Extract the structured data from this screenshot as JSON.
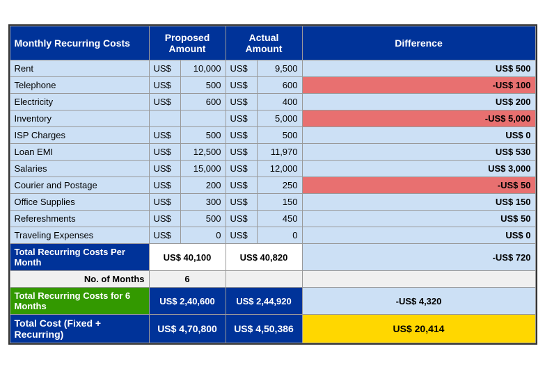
{
  "title": "Monthly Recurring Costs",
  "headers": {
    "category": "Monthly Recurring Costs",
    "proposed": "Proposed Amount",
    "actual": "Actual Amount",
    "difference": "Difference"
  },
  "rows": [
    {
      "name": "Rent",
      "prop_cur": "US$",
      "prop_val": "10,000",
      "act_cur": "US$",
      "act_val": "9,500",
      "diff": "US$ 500",
      "diff_type": "positive"
    },
    {
      "name": "Telephone",
      "prop_cur": "US$",
      "prop_val": "500",
      "act_cur": "US$",
      "act_val": "600",
      "diff": "-US$ 100",
      "diff_type": "negative"
    },
    {
      "name": "Electricity",
      "prop_cur": "US$",
      "prop_val": "600",
      "act_cur": "US$",
      "act_val": "400",
      "diff": "US$ 200",
      "diff_type": "positive"
    },
    {
      "name": "Inventory",
      "prop_cur": "",
      "prop_val": "",
      "act_cur": "US$",
      "act_val": "5,000",
      "diff": "-US$ 5,000",
      "diff_type": "negative"
    },
    {
      "name": "ISP Charges",
      "prop_cur": "US$",
      "prop_val": "500",
      "act_cur": "US$",
      "act_val": "500",
      "diff": "US$ 0",
      "diff_type": "positive"
    },
    {
      "name": "Loan EMI",
      "prop_cur": "US$",
      "prop_val": "12,500",
      "act_cur": "US$",
      "act_val": "11,970",
      "diff": "US$ 530",
      "diff_type": "positive"
    },
    {
      "name": "Salaries",
      "prop_cur": "US$",
      "prop_val": "15,000",
      "act_cur": "US$",
      "act_val": "12,000",
      "diff": "US$ 3,000",
      "diff_type": "positive"
    },
    {
      "name": "Courier and Postage",
      "prop_cur": "US$",
      "prop_val": "200",
      "act_cur": "US$",
      "act_val": "250",
      "diff": "-US$ 50",
      "diff_type": "negative"
    },
    {
      "name": "Office Supplies",
      "prop_cur": "US$",
      "prop_val": "300",
      "act_cur": "US$",
      "act_val": "150",
      "diff": "US$ 150",
      "diff_type": "positive"
    },
    {
      "name": "Refereshments",
      "prop_cur": "US$",
      "prop_val": "500",
      "act_cur": "US$",
      "act_val": "450",
      "diff": "US$ 50",
      "diff_type": "positive"
    },
    {
      "name": "Traveling Expenses",
      "prop_cur": "US$",
      "prop_val": "0",
      "act_cur": "US$",
      "act_val": "0",
      "diff": "US$ 0",
      "diff_type": "positive"
    }
  ],
  "total_month": {
    "label": "Total Recurring Costs Per Month",
    "prop": "US$    40,100",
    "act": "US$    40,820",
    "diff": "-US$ 720"
  },
  "months": {
    "label": "No. of Months",
    "value": "6"
  },
  "total6": {
    "label": "Total Recurring Costs for 6 Months",
    "prop": "US$ 2,40,600",
    "act": "US$ 2,44,920",
    "diff": "-US$ 4,320"
  },
  "grand": {
    "label": "Total Cost (Fixed + Recurring)",
    "prop": "US$ 4,70,800",
    "act": "US$ 4,50,386",
    "diff": "US$    20,414"
  }
}
